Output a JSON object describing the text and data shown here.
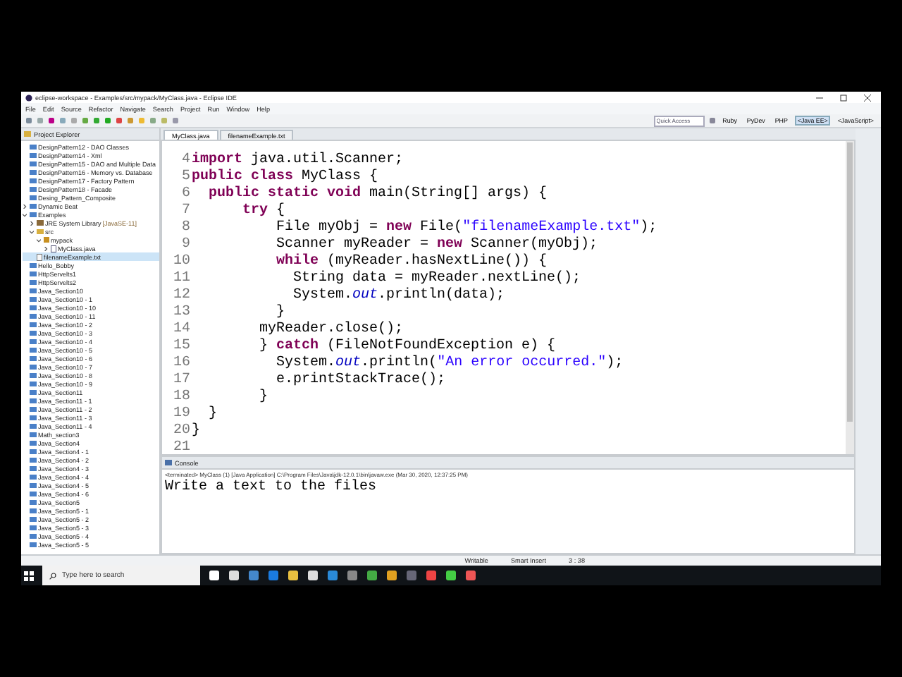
{
  "window": {
    "title": "eclipse-workspace - Examples/src/mypack/MyClass.java - Eclipse IDE"
  },
  "menu": [
    "File",
    "Edit",
    "Source",
    "Refactor",
    "Navigate",
    "Search",
    "Project",
    "Run",
    "Window",
    "Help"
  ],
  "toolbar": {
    "quick_access": {
      "placeholder": "Quick Access"
    },
    "perspectives": [
      {
        "label": "Ruby",
        "selected": false
      },
      {
        "label": "PyDev",
        "selected": false
      },
      {
        "label": "PHP",
        "selected": false
      },
      {
        "label": "<Java EE>",
        "selected": true
      },
      {
        "label": "<JavaScript>",
        "selected": false
      }
    ]
  },
  "project_explorer": {
    "title": "Project Explorer",
    "items": [
      {
        "label": "DesignPattern12 - DAO Classes",
        "kind": "project"
      },
      {
        "label": "DesignPattern14 - Xml",
        "kind": "project"
      },
      {
        "label": "DesignPattern15 - DAO and Multiple Data",
        "kind": "project"
      },
      {
        "label": "DesignPattern16 - Memory vs. Database",
        "kind": "project"
      },
      {
        "label": "DesignPattern17 - Factory Pattern",
        "kind": "project"
      },
      {
        "label": "DesignPattern18 - Facade",
        "kind": "project"
      },
      {
        "label": "Desing_Pattern_Composite",
        "kind": "project"
      },
      {
        "label": "Dynamic Beat",
        "kind": "project",
        "expanded": false
      },
      {
        "label": "Examples",
        "kind": "project",
        "expanded": true,
        "children": [
          {
            "label": "JRE System Library",
            "suffix": "[JavaSE-11]",
            "kind": "library",
            "expanded": false
          },
          {
            "label": "src",
            "kind": "folder",
            "expanded": true,
            "children": [
              {
                "label": "mypack",
                "kind": "package",
                "expanded": true,
                "children": [
                  {
                    "label": "MyClass.java",
                    "kind": "java",
                    "expanded": false
                  }
                ]
              }
            ]
          },
          {
            "label": "filenameExample.txt",
            "kind": "file",
            "selected": true
          }
        ]
      },
      {
        "label": "Hello_Bobby",
        "kind": "project"
      },
      {
        "label": "HttpServelts1",
        "kind": "project"
      },
      {
        "label": "HttpServelts2",
        "kind": "project"
      },
      {
        "label": "Java_Section10",
        "kind": "project"
      },
      {
        "label": "Java_Section10 - 1",
        "kind": "project"
      },
      {
        "label": "Java_Section10 - 10",
        "kind": "project"
      },
      {
        "label": "Java_Section10 - 11",
        "kind": "project"
      },
      {
        "label": "Java_Section10 - 2",
        "kind": "project"
      },
      {
        "label": "Java_Section10 - 3",
        "kind": "project"
      },
      {
        "label": "Java_Section10 - 4",
        "kind": "project"
      },
      {
        "label": "Java_Section10 - 5",
        "kind": "project"
      },
      {
        "label": "Java_Section10 - 6",
        "kind": "project"
      },
      {
        "label": "Java_Section10 - 7",
        "kind": "project"
      },
      {
        "label": "Java_Section10 - 8",
        "kind": "project"
      },
      {
        "label": "Java_Section10 - 9",
        "kind": "project"
      },
      {
        "label": "Java_Section11",
        "kind": "project"
      },
      {
        "label": "Java_Section11 - 1",
        "kind": "project"
      },
      {
        "label": "Java_Section11 - 2",
        "kind": "project"
      },
      {
        "label": "Java_Section11 - 3",
        "kind": "project"
      },
      {
        "label": "Java_Section11 - 4",
        "kind": "project"
      },
      {
        "label": "Math_section3",
        "kind": "project"
      },
      {
        "label": "Java_Section4",
        "kind": "project"
      },
      {
        "label": "Java_Section4 - 1",
        "kind": "project"
      },
      {
        "label": "Java_Section4 - 2",
        "kind": "project"
      },
      {
        "label": "Java_Section4 - 3",
        "kind": "project"
      },
      {
        "label": "Java_Section4 - 4",
        "kind": "project"
      },
      {
        "label": "Java_Section4 - 5",
        "kind": "project"
      },
      {
        "label": "Java_Section4 - 6",
        "kind": "project"
      },
      {
        "label": "Java_Section5",
        "kind": "project"
      },
      {
        "label": "Java_Section5 - 1",
        "kind": "project"
      },
      {
        "label": "Java_Section5 - 2",
        "kind": "project"
      },
      {
        "label": "Java_Section5 - 3",
        "kind": "project"
      },
      {
        "label": "Java_Section5 - 4",
        "kind": "project"
      },
      {
        "label": "Java_Section5 - 5",
        "kind": "project"
      }
    ]
  },
  "editor": {
    "tabs": [
      {
        "label": "MyClass.java",
        "selected": true
      },
      {
        "label": "filenameExample.txt",
        "selected": false
      }
    ],
    "lines": [
      {
        "number": "4",
        "tokens": [
          {
            "kind": "keyword",
            "text": "import"
          },
          {
            "kind": "plain",
            "text": " java.util.Scanner;"
          }
        ]
      },
      {
        "number": "5",
        "tokens": [
          {
            "kind": "keyword",
            "text": "public class"
          },
          {
            "kind": "plain",
            "text": " MyClass {"
          }
        ]
      },
      {
        "number": "6",
        "tokens": [
          {
            "kind": "keyword",
            "text": "  public static void"
          },
          {
            "kind": "plain",
            "text": " main(String[] args) {"
          }
        ]
      },
      {
        "number": "7",
        "tokens": [
          {
            "kind": "keyword",
            "text": "      try"
          },
          {
            "kind": "plain",
            "text": " {"
          }
        ]
      },
      {
        "number": "8",
        "tokens": [
          {
            "kind": "plain",
            "text": "          File myObj = "
          },
          {
            "kind": "keyword",
            "text": "new"
          },
          {
            "kind": "plain",
            "text": " File("
          },
          {
            "kind": "string",
            "text": "\"filenameExample.txt\""
          },
          {
            "kind": "plain",
            "text": ");"
          }
        ]
      },
      {
        "number": "9",
        "tokens": [
          {
            "kind": "plain",
            "text": "          Scanner myReader = "
          },
          {
            "kind": "keyword",
            "text": "new"
          },
          {
            "kind": "plain",
            "text": " Scanner(myObj);"
          }
        ]
      },
      {
        "number": "10",
        "tokens": [
          {
            "kind": "keyword",
            "text": "          while"
          },
          {
            "kind": "plain",
            "text": " (myReader.hasNextLine()) {"
          }
        ]
      },
      {
        "number": "11",
        "tokens": [
          {
            "kind": "plain",
            "text": "            String data = myReader.nextLine();"
          }
        ]
      },
      {
        "number": "12",
        "tokens": [
          {
            "kind": "plain",
            "text": "            System."
          },
          {
            "kind": "field",
            "text": "out"
          },
          {
            "kind": "plain",
            "text": ".println(data);"
          }
        ]
      },
      {
        "number": "13",
        "tokens": [
          {
            "kind": "plain",
            "text": "          }"
          }
        ]
      },
      {
        "number": "14",
        "tokens": [
          {
            "kind": "plain",
            "text": "        myReader.close();"
          }
        ]
      },
      {
        "number": "15",
        "tokens": [
          {
            "kind": "plain",
            "text": "        } "
          },
          {
            "kind": "keyword",
            "text": "catch"
          },
          {
            "kind": "plain",
            "text": " (FileNotFoundException e) {"
          }
        ]
      },
      {
        "number": "16",
        "tokens": [
          {
            "kind": "plain",
            "text": "          System."
          },
          {
            "kind": "field",
            "text": "out"
          },
          {
            "kind": "plain",
            "text": ".println("
          },
          {
            "kind": "string",
            "text": "\"An error occurred.\""
          },
          {
            "kind": "plain",
            "text": ");"
          }
        ]
      },
      {
        "number": "17",
        "tokens": [
          {
            "kind": "plain",
            "text": "          e.printStackTrace();"
          }
        ]
      },
      {
        "number": "18",
        "tokens": [
          {
            "kind": "plain",
            "text": "        }"
          }
        ]
      },
      {
        "number": "19",
        "tokens": [
          {
            "kind": "plain",
            "text": "  }"
          }
        ]
      },
      {
        "number": "20",
        "tokens": [
          {
            "kind": "plain",
            "text": "}"
          }
        ]
      },
      {
        "number": "21"
      }
    ]
  },
  "console": {
    "title": "Console",
    "info": "<terminated> MyClass (1) [Java Application] C:\\Program Files\\Java\\jdk-12.0.1\\bin\\javaw.exe (Mar 30, 2020, 12:37:25 PM)",
    "output": "Write a text to the files"
  },
  "status_bar": [
    "Writable",
    "Smart Insert",
    "3 : 38"
  ],
  "taskbar": {
    "search": {
      "placeholder": "Type here to search"
    }
  }
}
